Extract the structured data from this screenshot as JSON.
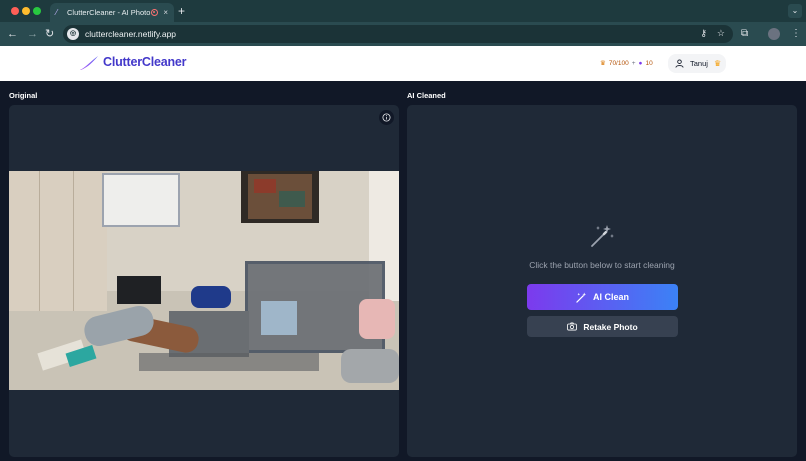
{
  "browser": {
    "tab_title": "ClutterCleaner - AI Photo",
    "tab_close": "×",
    "new_tab": "+",
    "url": "cluttercleaner.netlify.app"
  },
  "header": {
    "brand": "ClutterCleaner",
    "credits_usage": "70/100",
    "credits_plus": "+",
    "credits_bonus": "10",
    "user_name": "Tanuj"
  },
  "left_panel": {
    "label": "Original"
  },
  "right_panel": {
    "label": "AI Cleaned",
    "hint": "Click the button below to start cleaning",
    "clean_button": "AI Clean",
    "retake_button": "Retake Photo"
  },
  "colors": {
    "brand": "#4338ca",
    "gradient_start": "#7c3aed",
    "gradient_end": "#3b82f6",
    "panel_bg": "#1f2937",
    "page_bg": "#111827"
  },
  "icons": {
    "tab_favicon": "magic-wand-icon",
    "recording": "recording-icon",
    "info": "info-icon",
    "wand": "magic-wand-icon",
    "camera": "camera-icon",
    "user": "user-icon",
    "crown": "crown-icon"
  }
}
